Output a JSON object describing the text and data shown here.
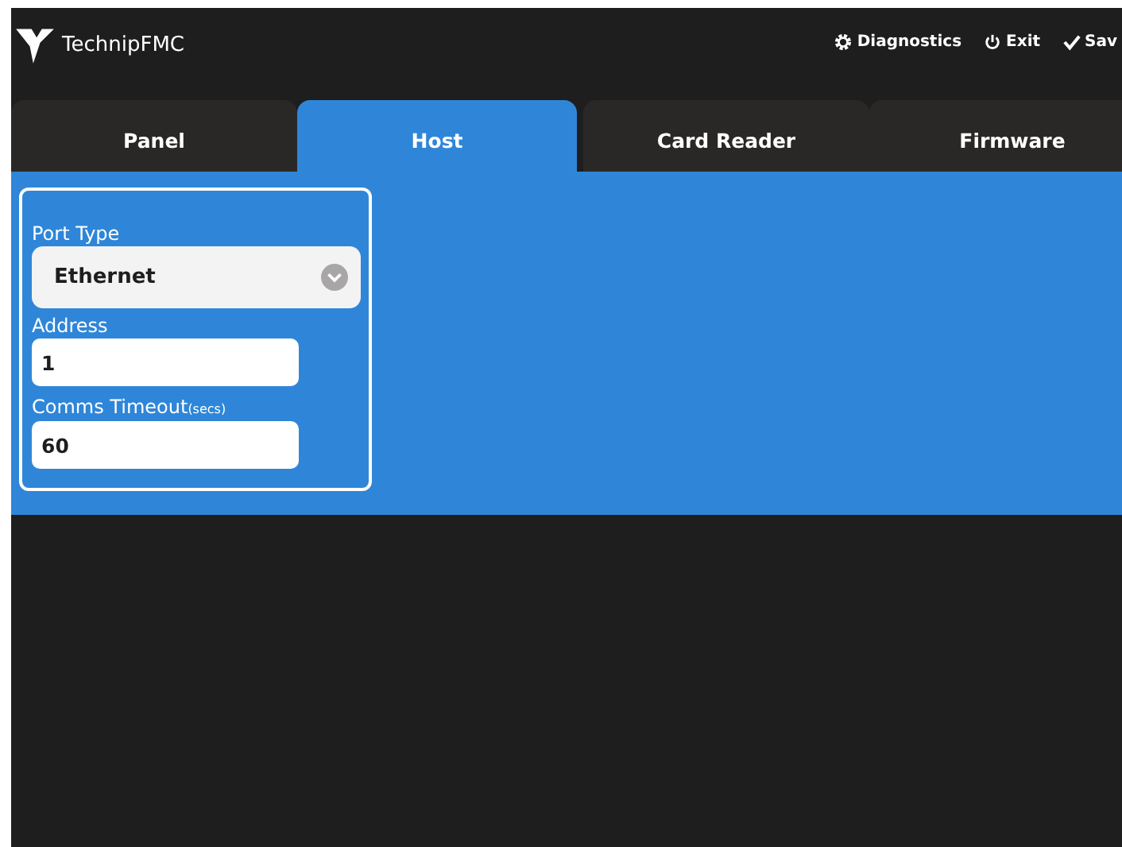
{
  "header": {
    "brand": "TechnipFMC",
    "actions": [
      {
        "kind": "gear",
        "label": "Diagnostics"
      },
      {
        "kind": "power",
        "label": "Exit"
      },
      {
        "kind": "check",
        "label": "Sav"
      }
    ]
  },
  "tabs": [
    {
      "label": "Panel",
      "selected": false
    },
    {
      "label": "Host",
      "selected": true
    },
    {
      "label": "Card Reader",
      "selected": false
    },
    {
      "label": "Firmware",
      "selected": false
    }
  ],
  "form": [
    {
      "kind": "select",
      "label": "Port Type",
      "value": "Ethernet"
    },
    {
      "kind": "text",
      "label": "Address",
      "value": "1"
    },
    {
      "kind": "text",
      "label": "Comms Timeout",
      "unit": "(secs)",
      "value": "60"
    }
  ]
}
